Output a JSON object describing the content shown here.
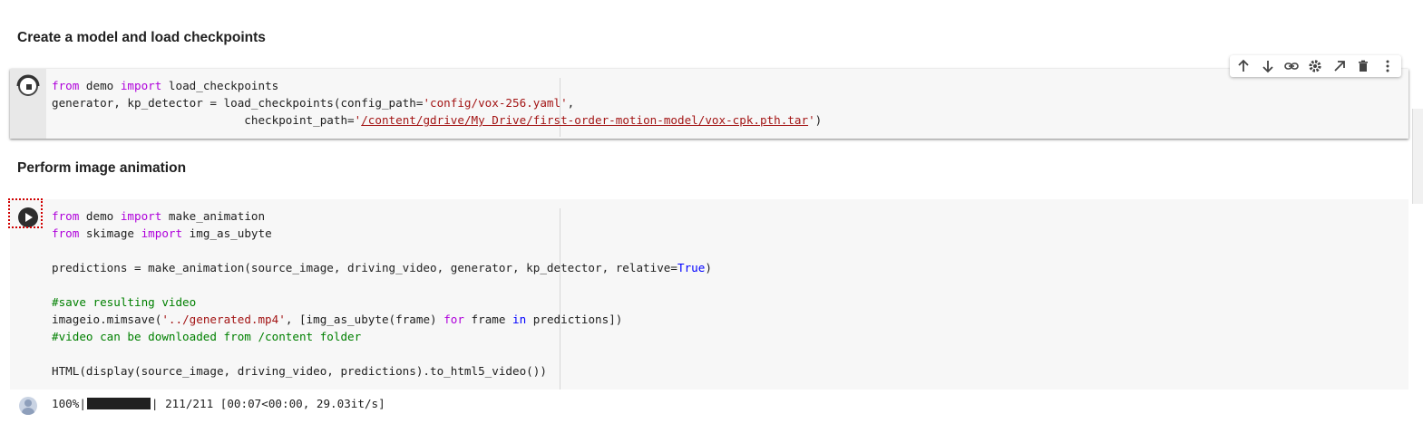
{
  "headings": {
    "create": "Create a model and load checkpoints",
    "perform": "Perform image animation"
  },
  "cell1": {
    "l1": {
      "kw_from": "from",
      "a": " demo ",
      "kw_import": "import",
      "b": " load_checkpoints"
    },
    "l2": {
      "a": "generator, kp_detector = load_checkpoints(config_path=",
      "str": "'config/vox-256.yaml'",
      "b": ","
    },
    "l3": {
      "a": "                            checkpoint_path=",
      "q1": "'",
      "path": "/content/gdrive/My Drive/first-order-motion-model/vox-cpk.pth.tar",
      "q2": "'",
      "b": ")"
    }
  },
  "cell2": {
    "l1": {
      "kw_from": "from",
      "a": " demo ",
      "kw_import": "import",
      "b": " make_animation"
    },
    "l2": {
      "kw_from": "from",
      "a": " skimage ",
      "kw_import": "import",
      "b": " img_as_ubyte"
    },
    "l4": {
      "a": "predictions = make_animation(source_image, driving_video, generator, kp_detector, relative=",
      "cst": "True",
      "b": ")"
    },
    "l6": {
      "cmt": "#save resulting video"
    },
    "l7": {
      "a": "imageio.mimsave(",
      "str": "'../generated.mp4'",
      "b": ", [img_as_ubyte(frame) ",
      "kw_for": "for",
      "c": " frame ",
      "kw_in": "in",
      "d": " predictions])"
    },
    "l8": {
      "cmt": "#video can be downloaded from /content folder"
    },
    "l10": {
      "a": "HTML(display(source_image, driving_video, predictions).to_html5_video())"
    }
  },
  "output": {
    "percent": "100%|",
    "progress": 1.0,
    "rest": "| 211/211 [00:07<00:00, 29.03it/s]"
  },
  "toolbar": {
    "icons": [
      "arrow-up-icon",
      "arrow-down-icon",
      "link-icon",
      "gear-icon",
      "open-in-new-icon",
      "trash-icon",
      "more-vert-icon"
    ]
  }
}
